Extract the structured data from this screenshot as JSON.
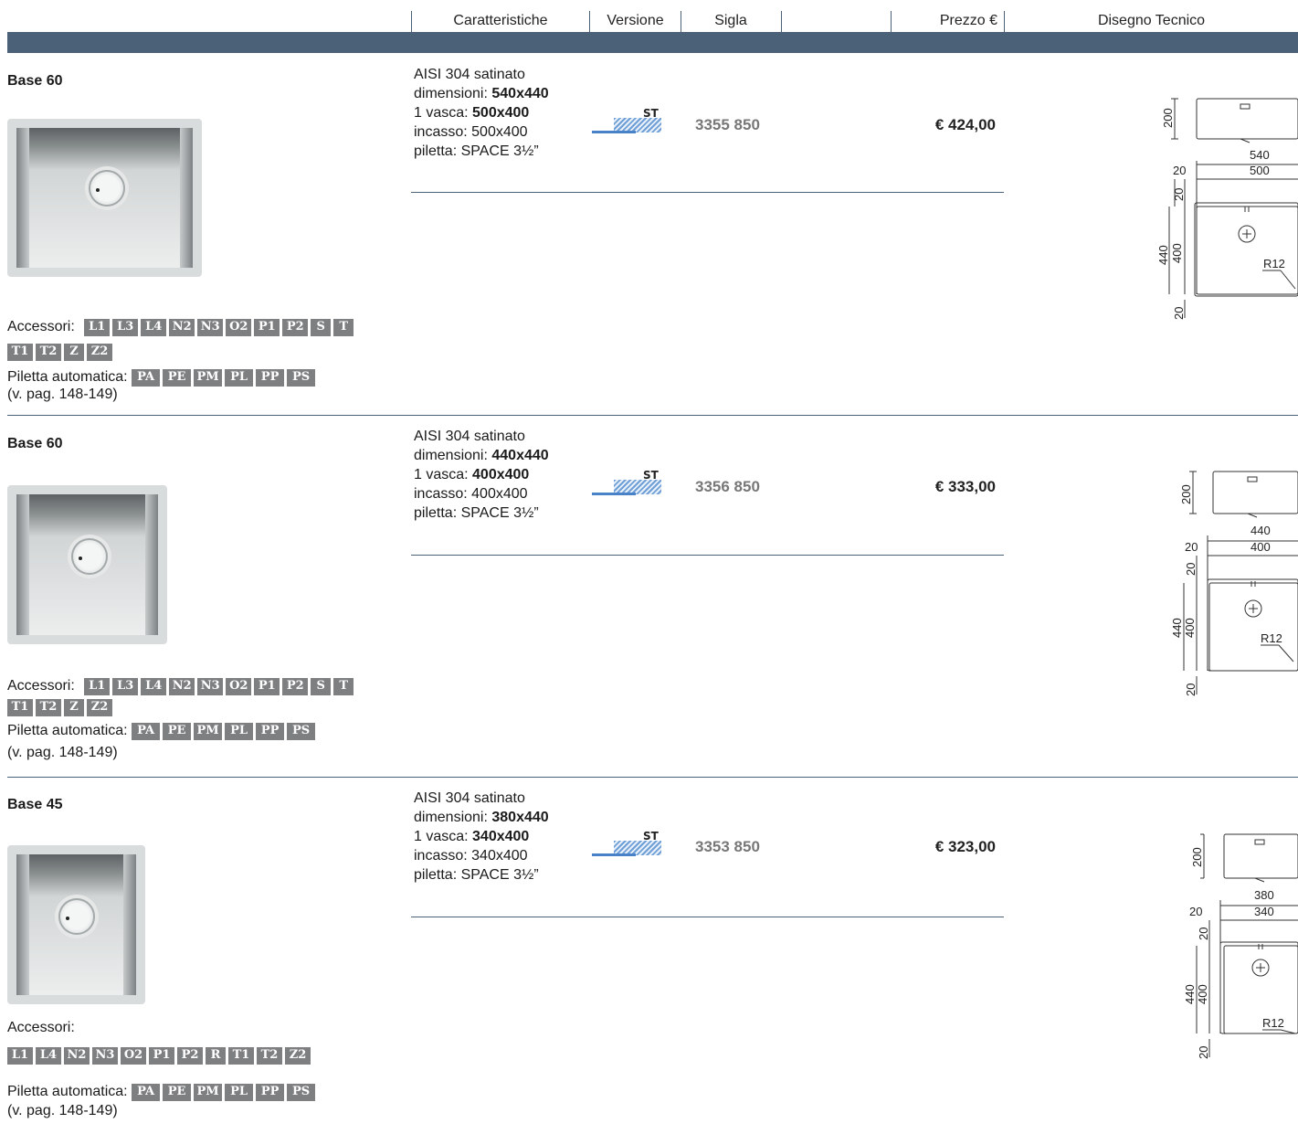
{
  "header": {
    "caratteristiche": "Caratteristiche",
    "versione": "Versione",
    "sigla": "Sigla",
    "prezzo": "Prezzo €",
    "disegno": "Disegno Tecnico"
  },
  "items": [
    {
      "title": "Base 60",
      "specs": {
        "l1": "AISI 304 satinato",
        "dim_label": "dimensioni: ",
        "dim_value": "540x440",
        "vasca_label": "1 vasca: ",
        "vasca_value": "500x400",
        "incasso": "incasso: 500x400",
        "piletta": "piletta: SPACE 3½”"
      },
      "version": "ST",
      "code": "3355 850",
      "price": "€ 424,00",
      "accessori_label": "Accessori:",
      "accessori_row1": [
        "L1",
        "L3",
        "L4",
        "N2",
        "N3",
        "O2",
        "P1",
        "P2",
        "S",
        "T"
      ],
      "accessori_row2": [
        "T1",
        "T2",
        "Z",
        "Z2"
      ],
      "piletta_label": "Piletta automatica:",
      "piletta_badges": [
        "PA",
        "PE",
        "PM",
        "PL",
        "PP",
        "PS"
      ],
      "page_ref": "(v. pag. 148-149)",
      "drawing": {
        "h": "200",
        "outer": "540",
        "left": "20",
        "inner": "500",
        "top": "20",
        "depth_outer": "440",
        "depth_inner": "400",
        "bottom": "20",
        "radius": "R12"
      }
    },
    {
      "title": "Base 60",
      "specs": {
        "l1": "AISI 304 satinato",
        "dim_label": "dimensioni: ",
        "dim_value": "440x440",
        "vasca_label": "1 vasca: ",
        "vasca_value": "400x400",
        "incasso": "incasso: 400x400",
        "piletta": "piletta: SPACE 3½”"
      },
      "version": "ST",
      "code": "3356 850",
      "price": "€ 333,00",
      "accessori_label": "Accessori:",
      "accessori_row1": [
        "L1",
        "L3",
        "L4",
        "N2",
        "N3",
        "O2",
        "P1",
        "P2",
        "S",
        "T"
      ],
      "accessori_row2": [
        "T1",
        "T2",
        "Z",
        "Z2"
      ],
      "piletta_label": "Piletta automatica:",
      "piletta_badges": [
        "PA",
        "PE",
        "PM",
        "PL",
        "PP",
        "PS"
      ],
      "page_ref": "(v. pag. 148-149)",
      "drawing": {
        "h": "200",
        "outer": "440",
        "left": "20",
        "inner": "400",
        "top": "20",
        "depth_outer": "440",
        "depth_inner": "400",
        "bottom": "20",
        "radius": "R12"
      }
    },
    {
      "title": "Base 45",
      "specs": {
        "l1": "AISI 304 satinato",
        "dim_label": "dimensioni: ",
        "dim_value": "380x440",
        "vasca_label": "1 vasca: ",
        "vasca_value": "340x400",
        "incasso": "incasso: 340x400",
        "piletta": "piletta: SPACE 3½”"
      },
      "version": "ST",
      "code": "3353 850",
      "price": "€ 323,00",
      "accessori_label": "Accessori:",
      "accessori_row1": [
        "L1",
        "L4",
        "N2",
        "N3",
        "O2",
        "P1",
        "P2",
        "R",
        "T1",
        "T2",
        "Z2"
      ],
      "piletta_label": "Piletta automatica:",
      "piletta_badges": [
        "PA",
        "PE",
        "PM",
        "PL",
        "PP",
        "PS"
      ],
      "page_ref": "(v. pag. 148-149)",
      "drawing": {
        "h": "200",
        "outer": "380",
        "left": "20",
        "inner": "340",
        "top": "20",
        "depth_outer": "440",
        "depth_inner": "400",
        "bottom": "20",
        "radius": "R12"
      }
    }
  ]
}
